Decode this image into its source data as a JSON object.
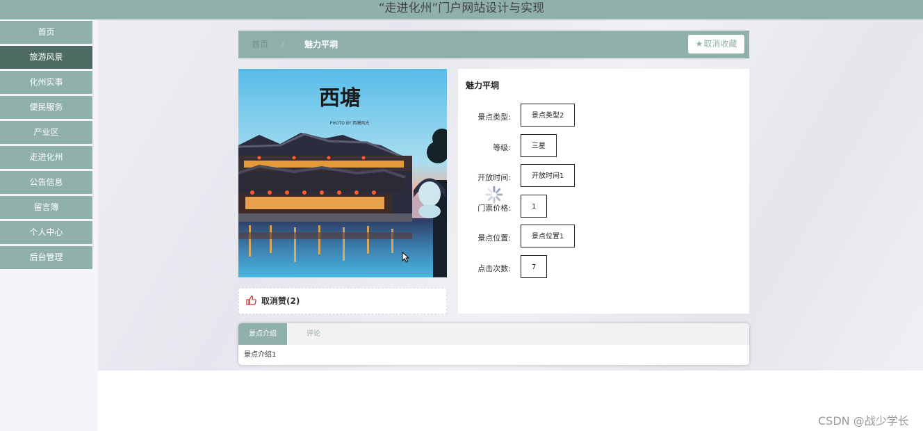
{
  "app": {
    "title": "“走进化州”门户网站设计与实现"
  },
  "sidebar": {
    "items": [
      {
        "label": "首页"
      },
      {
        "label": "旅游风景",
        "active": true
      },
      {
        "label": "化州实事"
      },
      {
        "label": "便民服务"
      },
      {
        "label": "产业区"
      },
      {
        "label": "走进化州"
      },
      {
        "label": "公告信息"
      },
      {
        "label": "留言簿"
      },
      {
        "label": "个人中心"
      },
      {
        "label": "后台管理"
      }
    ]
  },
  "breadcrumb": {
    "home": "首页",
    "separator": "/",
    "current": "魅力平垌"
  },
  "favorite": {
    "label": "取消收藏",
    "icon": "star-icon"
  },
  "photo": {
    "caption_main": "西塘",
    "caption_sub": "PHOTO BY 西塘风光"
  },
  "like": {
    "label": "取消赞(2)",
    "icon": "thumbs-up-icon"
  },
  "detail": {
    "title": "魅力平垌",
    "fields": [
      {
        "label": "景点类型:",
        "value": "景点类型2"
      },
      {
        "label": "等级:",
        "value": "三星"
      },
      {
        "label": "开放时间:",
        "value": "开放时间1"
      },
      {
        "label": "门票价格:",
        "value": "1"
      },
      {
        "label": "景点位置:",
        "value": "景点位置1"
      },
      {
        "label": "点击次数:",
        "value": "7"
      }
    ]
  },
  "tabs": {
    "items": [
      {
        "label": "景点介绍",
        "active": true
      },
      {
        "label": "评论"
      }
    ],
    "content": "景点介绍1"
  },
  "watermark": "CSDN @战少学长",
  "colors": {
    "accent": "#8fb1aa",
    "accent_dark": "#4d6b62",
    "like_red": "#d9303a"
  }
}
